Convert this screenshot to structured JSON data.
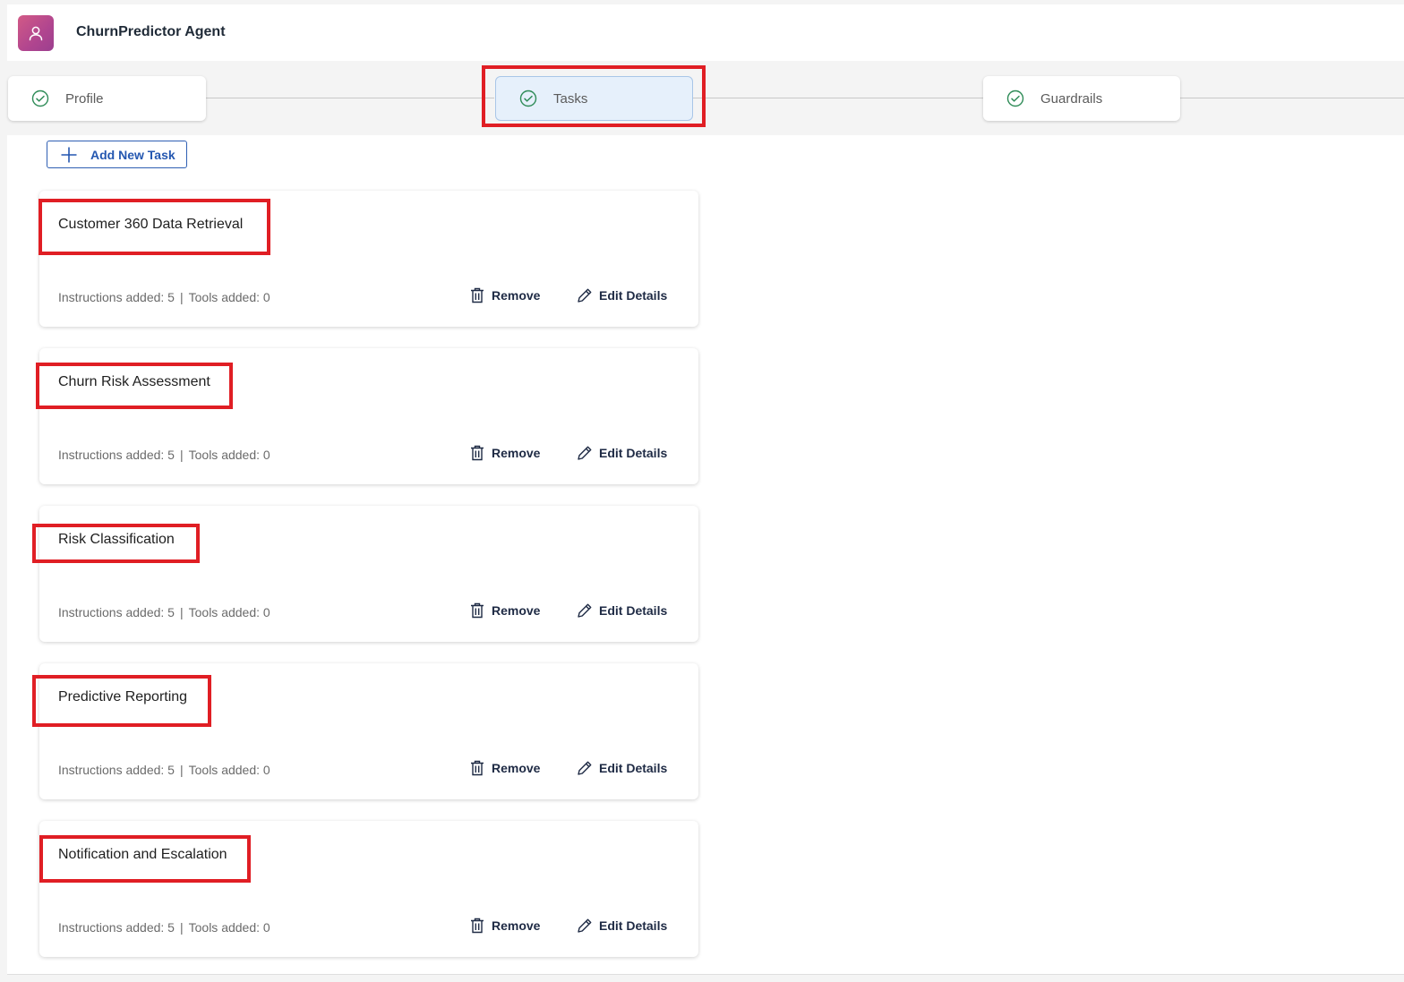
{
  "header": {
    "title": "ChurnPredictor Agent",
    "avatar_icon": "user-icon"
  },
  "steps": [
    {
      "label": "Profile",
      "icon": "check-circle-icon"
    },
    {
      "label": "Tasks",
      "icon": "check-circle-icon"
    },
    {
      "label": "Guardrails",
      "icon": "check-circle-icon"
    }
  ],
  "toolbar": {
    "add_task_label": "Add New Task"
  },
  "tasks": [
    {
      "title": "Customer 360 Data Retrieval",
      "instructions": "Instructions added: 5",
      "tools": "Tools added: 0",
      "remove_label": "Remove",
      "edit_label": "Edit Details"
    },
    {
      "title": "Churn Risk Assessment",
      "instructions": "Instructions added: 5",
      "tools": "Tools added: 0",
      "remove_label": "Remove",
      "edit_label": "Edit Details"
    },
    {
      "title": "Risk Classification",
      "instructions": "Instructions added: 5",
      "tools": "Tools added: 0",
      "remove_label": "Remove",
      "edit_label": "Edit Details"
    },
    {
      "title": "Predictive Reporting",
      "instructions": "Instructions added: 5",
      "tools": "Tools added: 0",
      "remove_label": "Remove",
      "edit_label": "Edit Details"
    },
    {
      "title": "Notification and Escalation",
      "instructions": "Instructions added: 5",
      "tools": "Tools added: 0",
      "remove_label": "Remove",
      "edit_label": "Edit Details"
    }
  ],
  "colors": {
    "accent": "#2457b0",
    "highlight": "#e01e24",
    "success": "#2e8b57"
  }
}
